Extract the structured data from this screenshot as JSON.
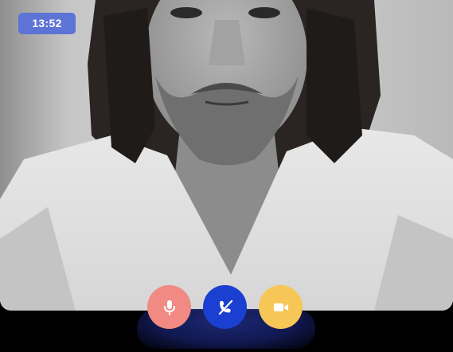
{
  "call": {
    "timer": "13:52"
  },
  "controls": [
    {
      "name": "mic",
      "icon": "microphone-icon",
      "color": "#f08a82"
    },
    {
      "name": "end-call",
      "icon": "phone-hangup-icon",
      "color": "#1b3fd0"
    },
    {
      "name": "video",
      "icon": "video-camera-icon",
      "color": "#f6c657"
    }
  ],
  "colors": {
    "timer_badge": "#5d73d6",
    "background": "#000000"
  }
}
